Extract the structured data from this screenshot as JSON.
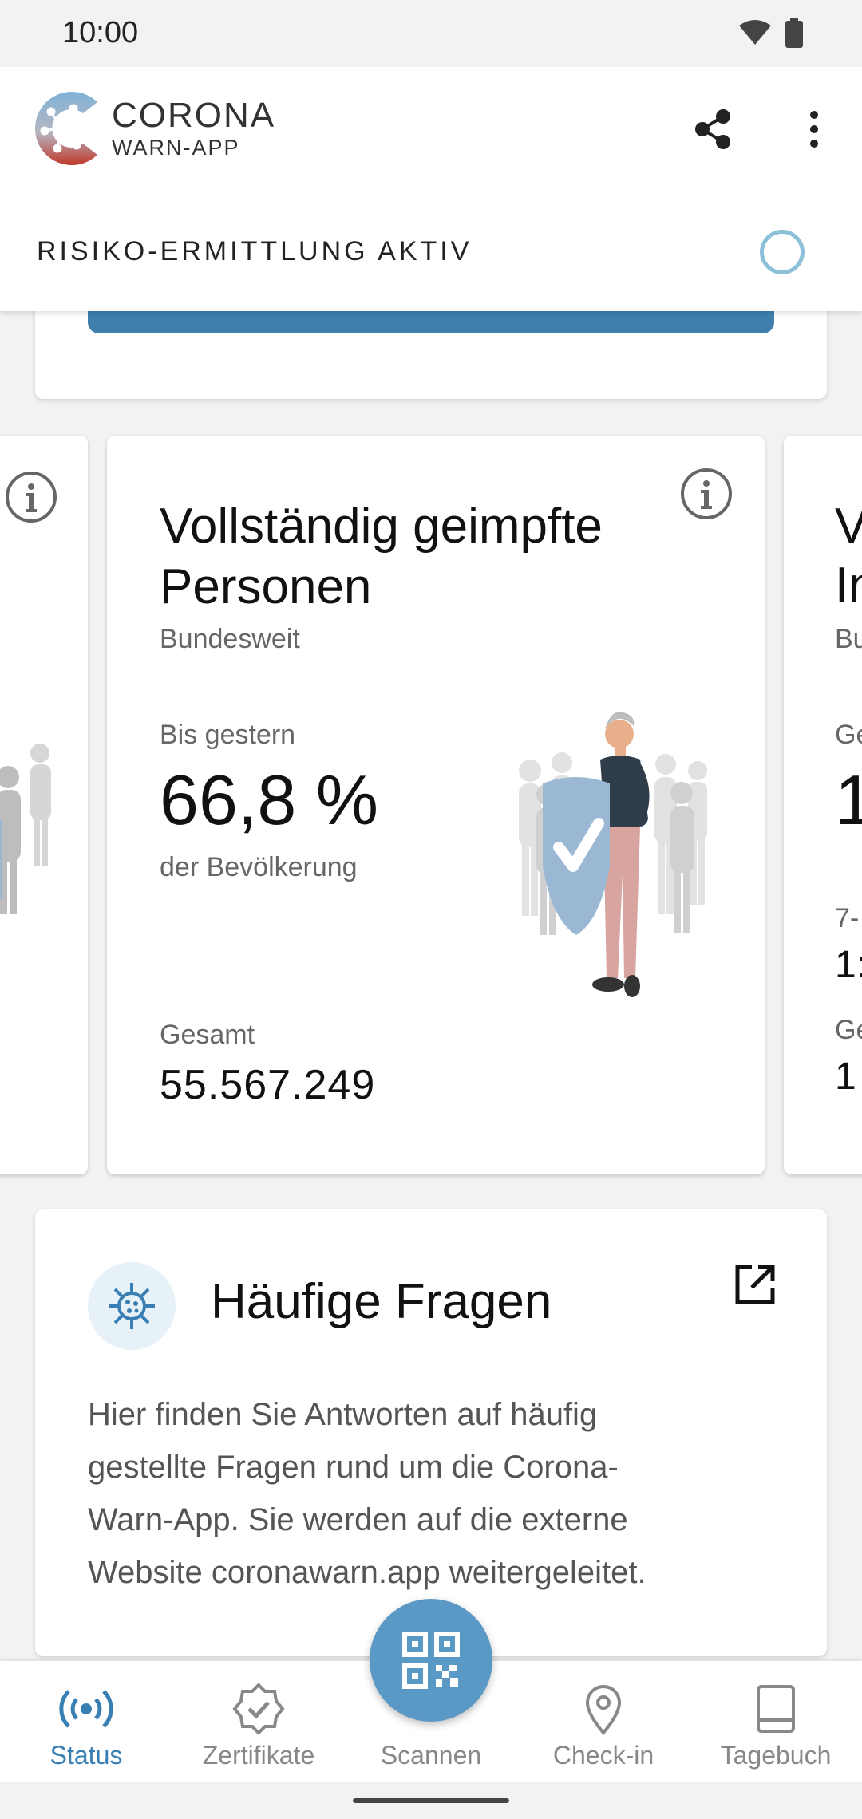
{
  "status_bar": {
    "time": "10:00"
  },
  "app_bar": {
    "logo_line1": "CORONA",
    "logo_line2": "WARN-APP"
  },
  "risk_strip": {
    "label": "RISIKO-ERMITTLUNG AKTIV"
  },
  "vaccination_card": {
    "title": "Vollständig geimpfte Personen",
    "subtitle": "Bundesweit",
    "period_label": "Bis gestern",
    "value": "66,8 %",
    "value_caption": "der Bevölkerung",
    "total_label": "Gesamt",
    "total_value": "55.567.249"
  },
  "next_card_peek": {
    "title_line1": "V",
    "title_line2": "In",
    "subtitle": "Bu",
    "k1": "Ge",
    "big": "1",
    "k2": "7-",
    "v2": "1:",
    "k3": "Ge",
    "v3": "1"
  },
  "faq_card": {
    "title": "Häufige Fragen",
    "body": "Hier finden Sie Antworten auf häufig gestellte Fragen rund um die Corona-Warn-App. Sie werden auf die externe Website coronawarn.app weitergeleitet."
  },
  "bottom_nav": {
    "items": [
      {
        "label": "Status",
        "icon": "status-broadcast-icon"
      },
      {
        "label": "Zertifikate",
        "icon": "certificate-badge-icon"
      },
      {
        "label": "Scannen",
        "icon": "qr-code-icon"
      },
      {
        "label": "Check-in",
        "icon": "location-pin-icon"
      },
      {
        "label": "Tagebuch",
        "icon": "diary-book-icon"
      }
    ]
  },
  "colors": {
    "accent": "#3a7fb3",
    "fab": "#5a98c6",
    "ring": "#8cc0d8"
  }
}
